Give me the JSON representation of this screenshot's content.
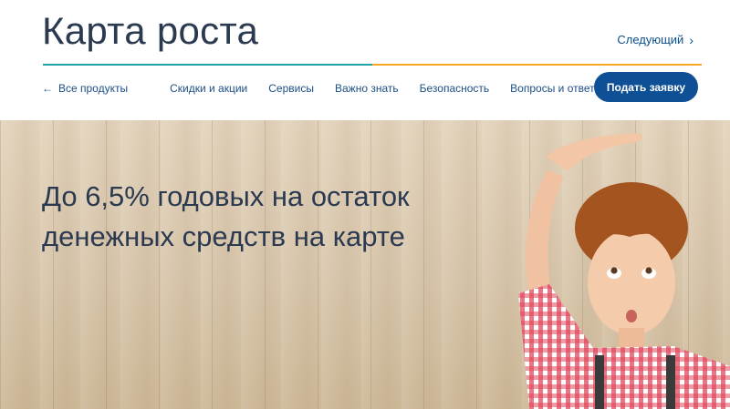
{
  "header": {
    "title": "Карта роста",
    "next_link": "Следующий",
    "nav": {
      "back_label": "Все продукты",
      "items": [
        "Скидки и акции",
        "Сервисы",
        "Важно знать",
        "Безопасность",
        "Вопросы и ответы"
      ]
    },
    "apply_button": "Подать заявку"
  },
  "hero": {
    "headline_line1": "До 6,5% годовых на остаток",
    "headline_line2": "денежных средств на карте",
    "image": "child-measuring-height-photo"
  },
  "colors": {
    "brand_blue": "#0e4f96",
    "divider_teal": "#20a3a3",
    "divider_orange": "#f6a623",
    "title_text": "#2b3a50"
  }
}
